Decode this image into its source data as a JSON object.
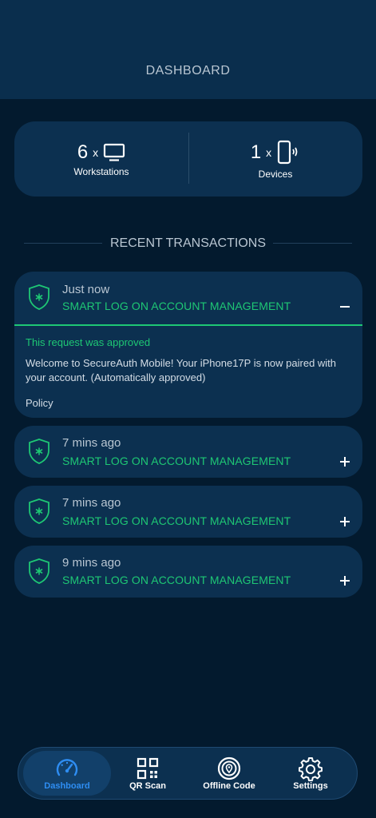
{
  "header": {
    "title": "DASHBOARD"
  },
  "summary": {
    "workstations": {
      "count": "6",
      "times": "x",
      "label": "Workstations",
      "icon": "monitor-icon"
    },
    "devices": {
      "count": "1",
      "times": "x",
      "label": "Devices",
      "icon": "phone-icon"
    }
  },
  "section": {
    "title": "RECENT TRANSACTIONS"
  },
  "transactions": [
    {
      "time": "Just now",
      "name": "SMART LOG ON ACCOUNT MANAGEMENT",
      "expanded": true,
      "status": "This request was approved",
      "message": "Welcome to SecureAuth Mobile! Your iPhone17P  is now paired with your account. (Automatically approved)",
      "policy_label": "Policy",
      "toggle_icon": "minus-icon"
    },
    {
      "time": "7 mins ago",
      "name": "SMART LOG ON ACCOUNT MANAGEMENT",
      "expanded": false,
      "toggle_icon": "plus-icon"
    },
    {
      "time": "7 mins ago",
      "name": "SMART LOG ON ACCOUNT MANAGEMENT",
      "expanded": false,
      "toggle_icon": "plus-icon"
    },
    {
      "time": "9 mins ago",
      "name": "SMART LOG ON ACCOUNT MANAGEMENT",
      "expanded": false,
      "toggle_icon": "plus-icon"
    }
  ],
  "nav": {
    "items": [
      {
        "label": "Dashboard",
        "icon": "speedometer-icon",
        "active": true
      },
      {
        "label": "QR Scan",
        "icon": "qr-code-icon",
        "active": false
      },
      {
        "label": "Offline Code",
        "icon": "location-target-icon",
        "active": false
      },
      {
        "label": "Settings",
        "icon": "gear-icon",
        "active": false
      }
    ]
  },
  "colors": {
    "accent_green": "#1ec774",
    "accent_blue": "#2e8df2",
    "background": "#031a2e",
    "card": "#0c3050"
  }
}
